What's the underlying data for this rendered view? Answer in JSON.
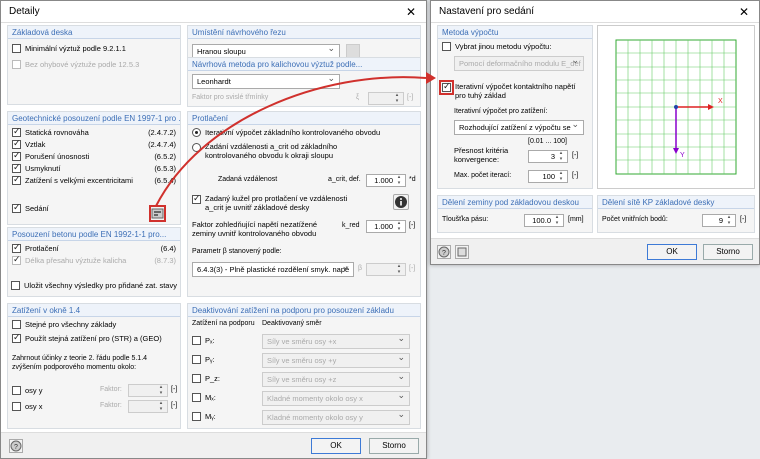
{
  "left": {
    "title": "Detaily",
    "close": "✕",
    "zakladova": {
      "head": "Základová deska",
      "min": "Minimální výztuž podle 9.2.1.1",
      "bez": "Bez ohybové výztuže podle 12.5.3"
    },
    "geotech": {
      "head": "Geotechnické posouzení podle EN 1997-1 pro ...",
      "items": [
        {
          "label": "Statická rovnováha",
          "ref": "(2.4.7.2)"
        },
        {
          "label": "Vztlak",
          "ref": "(2.4.7.4)"
        },
        {
          "label": "Porušení únosnosti",
          "ref": "(6.5.2)"
        },
        {
          "label": "Usmyknutí",
          "ref": "(6.5.3)"
        },
        {
          "label": "Zatížení s velkými excentricitami",
          "ref": "(6.5.4)"
        }
      ],
      "sedani": "Sedání"
    },
    "beton": {
      "head": "Posouzení betonu podle EN 1992-1-1 pro...",
      "protlaceni": "Protlačení",
      "protlaceni_ref": "(6.4)",
      "delka": "Délka přesahu výztuže kalicha",
      "delka_ref": "(8.7.3)",
      "ulozit": "Uložit všechny výsledky pro přidané zat. stavy"
    },
    "umisteni": {
      "head": "Umístění návrhového řezu",
      "value": "Hranou sloupu"
    },
    "navrhova": {
      "head": "Návrhová metoda pro kalichovou výztuž podle...",
      "value": "Leonhardt",
      "faktor": "Faktor pro svislé třmínky",
      "faktor_sym": "ξ",
      "faktor_unit": "[-]"
    },
    "protlac": {
      "head": "Protlačení",
      "r1": "Iterativní výpočet základního kontrolovaného obvodu",
      "r2": "Zadání vzdálenosti a_crit od základního kontrolovaného obvodu k okraji sloupu",
      "zadana": "Zadaná vzdálenost",
      "zadana_sym": "a_crit, def.",
      "zadana_val": "1.000",
      "zadana_unit": "*d",
      "kuzel": "Zadaný kužel pro protlačení ve vzdálenosti a_crit je uvnitř základové desky",
      "faktor": "Faktor zohledňující napětí nezatížené zeminy uvnitř kontrolovaného obvodu",
      "faktor_sym": "k_red",
      "faktor_val": "1.000",
      "faktor_unit": "[-]",
      "param": "Parametr β stanovený podle:",
      "param_val": "6.4.3(3) - Plně plastické rozdělení smyk. napě",
      "beta": "β",
      "beta_unit": "[-]"
    },
    "zat": {
      "head": "Zatížení v okně 1.4",
      "stejne": "Stejné pro všechny základy",
      "pouzit": "Použít stejná zatížení pro (STR) a (GEO)",
      "note": "Zahrnout účinky z teorie 2. řádu podle 5.1.4 zvýšením podporového momentu okolo:",
      "osa_y": "osy y",
      "osa_x": "osy x",
      "faktor": "Faktor:",
      "unit": "[-]"
    },
    "deakt": {
      "head": "Deaktivování zatížení na podporu pro posouzení základu",
      "col1": "Zatížení na podporu",
      "col2": "Deaktivovaný směr",
      "rows": [
        {
          "label": "Pₓ:",
          "val": "Síly ve směru osy +x"
        },
        {
          "label": "Pᵧ:",
          "val": "Síly ve směru osy +y"
        },
        {
          "label": "P_z:",
          "val": "Síly ve směru osy +z"
        },
        {
          "label": "Mₓ:",
          "val": "Kladné momenty okolo osy x"
        },
        {
          "label": "Mᵧ:",
          "val": "Kladné momenty okolo osy y"
        }
      ]
    },
    "ok": "OK",
    "cancel": "Storno"
  },
  "right": {
    "title": "Nastavení pro sedání",
    "close": "✕",
    "metoda": {
      "head": "Metoda výpočtu",
      "vybrat": "Vybrat jinou metodu výpočtu:",
      "pomoci": "Pomocí deformačního modulu E_def",
      "iter": "Iterativní výpočet kontaktního napětí pro tuhý základ",
      "iter_pro": "Iterativní výpočet pro zatížení:",
      "iter_val": "Rozhodující zatížení z výpočtu se",
      "presnost": "Přesnost kritéria konvergence:",
      "range": "[0.01 ... 100]",
      "presnost_val": "3",
      "unit": "[-]",
      "max": "Max. počet iterací:",
      "max_val": "100"
    },
    "deleni": {
      "head": "Dělení zeminy pod základovou deskou",
      "tloustka": "Tloušťka pásu:",
      "tloustka_val": "100.0",
      "tloustka_unit": "[mm]"
    },
    "sit": {
      "head": "Dělení sítě KP základové desky",
      "pocet": "Počet vnitřních bodů:",
      "pocet_val": "9",
      "unit": "[-]"
    },
    "axes": {
      "x": "X",
      "y": "Y"
    },
    "ok": "OK",
    "cancel": "Storno"
  }
}
